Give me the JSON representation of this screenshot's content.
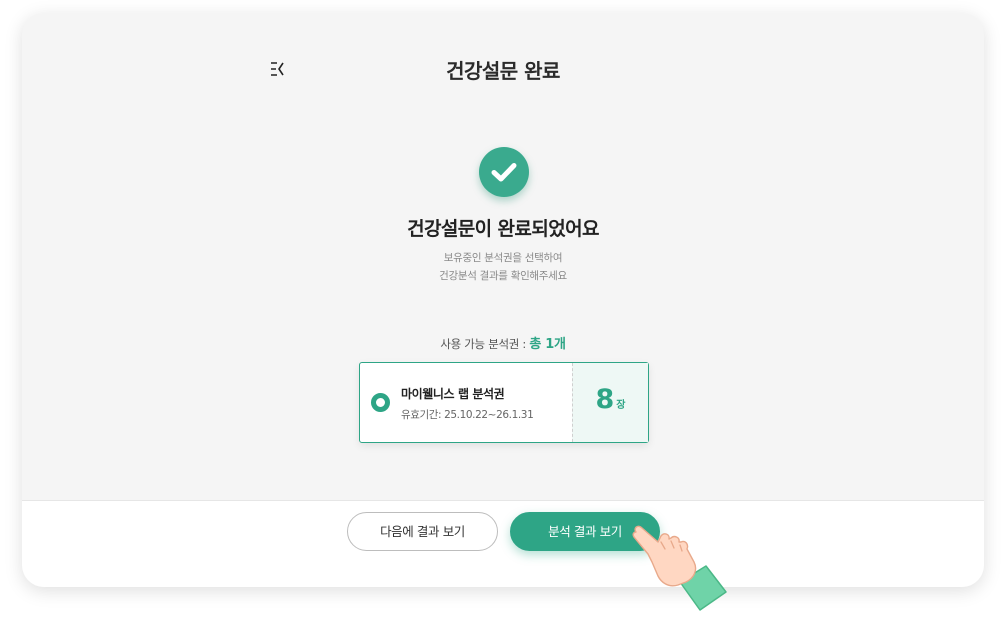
{
  "header": {
    "title": "건강설문 완료",
    "back_icon": "back-arrow-icon"
  },
  "result": {
    "icon": "check-circle-icon",
    "headline": "건강설문이 완료되었어요",
    "description_line1": "보유중인 분석권을 선택하여",
    "description_line2": "건강분석 결과를 확인해주세요"
  },
  "available": {
    "label": "사용 가능 분석권 : ",
    "count": "총 1개"
  },
  "voucher": {
    "name": "마이웰니스 랩 분석권",
    "period": "유효기간: 25.10.22~26.1.31",
    "quantity": "8",
    "unit": "장",
    "selected": true
  },
  "footer": {
    "later_button": "다음에 결과 보기",
    "view_button": "분석 결과 보기"
  },
  "colors": {
    "accent": "#2ea586",
    "background": "#f5f5f5"
  }
}
